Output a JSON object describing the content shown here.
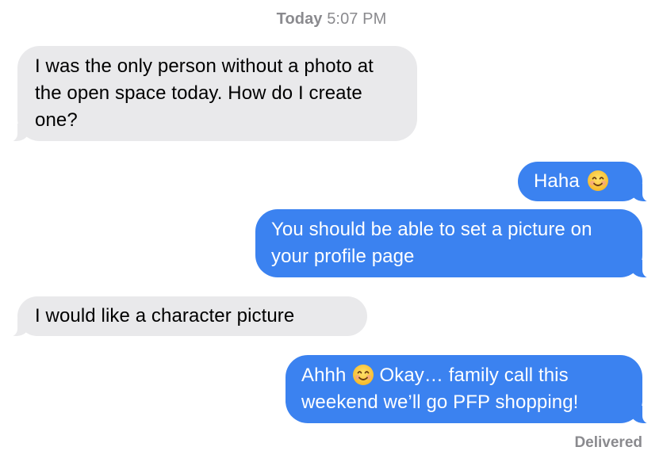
{
  "header": {
    "day": "Today",
    "time": "5:07 PM"
  },
  "messages": [
    {
      "direction": "incoming",
      "text": "I was the only person without a photo at the open space today. How do I create one?"
    },
    {
      "direction": "outgoing",
      "text": "Haha",
      "emoji_after": "smiling-face-icon"
    },
    {
      "direction": "outgoing",
      "text": "You should be able to set a picture on your profile page"
    },
    {
      "direction": "incoming",
      "text": "I would like a character picture"
    },
    {
      "direction": "outgoing",
      "text_before": "Ahhh",
      "emoji": "smiling-face-icon",
      "text_after": "Okay… family call this weekend we’ll go PFP shopping!"
    }
  ],
  "status": "Delivered",
  "colors": {
    "incoming_bubble": "#e9e9eb",
    "outgoing_bubble": "#3b82f0",
    "meta_text": "#8a8a8e"
  }
}
